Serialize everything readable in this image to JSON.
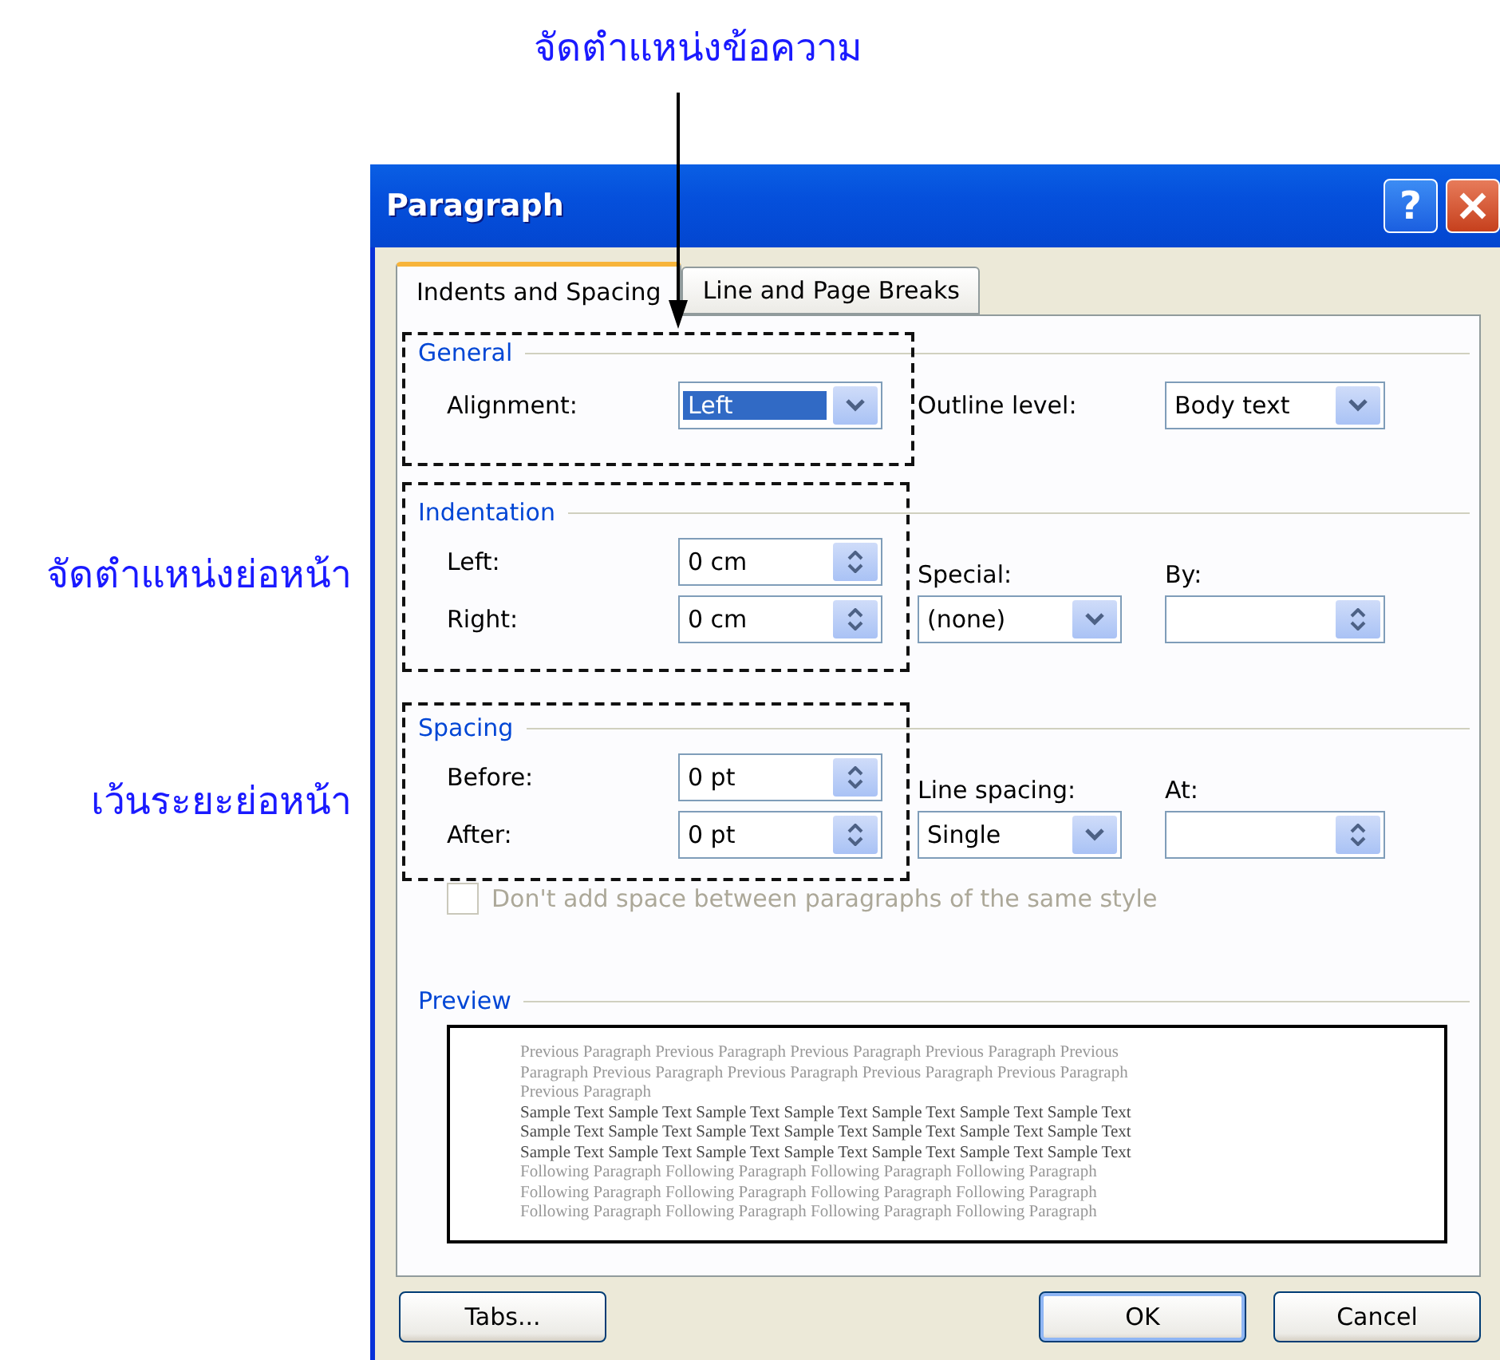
{
  "annotations": {
    "top": "จัดตำแหน่งข้อความ",
    "indentation": "จัดตำแหน่งย่อหน้า",
    "spacing": "เว้นระยะย่อหน้า"
  },
  "window": {
    "title": "Paragraph",
    "help": "?"
  },
  "tabs": [
    {
      "label": "Indents and Spacing",
      "selected": true
    },
    {
      "label": "Line and Page Breaks",
      "selected": false
    }
  ],
  "general": {
    "title": "General",
    "alignment": {
      "label": "Alignment:",
      "value": "Left",
      "highlighted": true
    },
    "outline_level": {
      "label": "Outline level:",
      "value": "Body text"
    }
  },
  "indentation": {
    "title": "Indentation",
    "left": {
      "label": "Left:",
      "value": "0 cm"
    },
    "right": {
      "label": "Right:",
      "value": "0 cm"
    },
    "special": {
      "label": "Special:",
      "value": "(none)"
    },
    "by": {
      "label": "By:"
    }
  },
  "spacing": {
    "title": "Spacing",
    "before": {
      "label": "Before:",
      "value": "0 pt"
    },
    "after": {
      "label": "After:",
      "value": "0 pt"
    },
    "line_spacing": {
      "label": "Line spacing:",
      "value": "Single"
    },
    "at": {
      "label": "At:"
    }
  },
  "checkbox": {
    "label": "Don't add space between paragraphs of the same style",
    "checked": false,
    "disabled": true
  },
  "preview": {
    "title": "Preview",
    "lines": [
      {
        "kind": "previous",
        "text": "Previous Paragraph Previous Paragraph Previous Paragraph Previous Paragraph Previous"
      },
      {
        "kind": "previous",
        "text": "Paragraph Previous Paragraph Previous Paragraph Previous Paragraph Previous Paragraph"
      },
      {
        "kind": "previous",
        "text": "Previous Paragraph"
      },
      {
        "kind": "sample",
        "text": "Sample Text Sample Text Sample Text Sample Text Sample Text Sample Text Sample Text"
      },
      {
        "kind": "sample",
        "text": "Sample Text Sample Text Sample Text Sample Text Sample Text Sample Text Sample Text"
      },
      {
        "kind": "sample",
        "text": "Sample Text Sample Text Sample Text Sample Text Sample Text Sample Text Sample Text"
      },
      {
        "kind": "following",
        "text": "Following Paragraph Following Paragraph Following Paragraph Following Paragraph"
      },
      {
        "kind": "following",
        "text": "Following Paragraph Following Paragraph Following Paragraph Following Paragraph"
      },
      {
        "kind": "following",
        "text": "Following Paragraph Following Paragraph Following Paragraph Following Paragraph"
      }
    ]
  },
  "buttons": [
    {
      "label": "Tabs...",
      "default": false
    },
    {
      "label": "OK",
      "default": true
    },
    {
      "label": "Cancel",
      "default": false
    }
  ]
}
